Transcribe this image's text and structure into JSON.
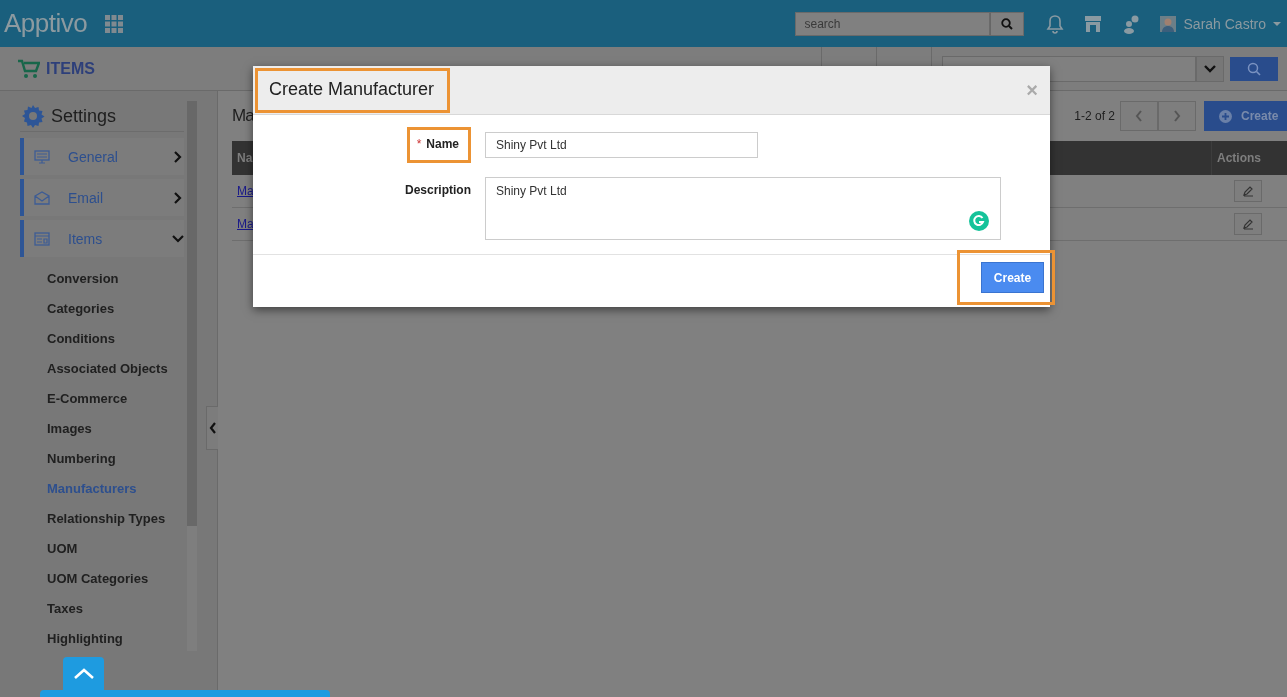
{
  "top_bar": {
    "logo": "Apptivo",
    "search": {
      "placeholder": "search"
    },
    "user": "Sarah Castro"
  },
  "app_bar": {
    "title": "ITEMS"
  },
  "sidebar": {
    "title": "Settings",
    "sections": [
      {
        "label": "General",
        "expanded": false
      },
      {
        "label": "Email",
        "expanded": false
      },
      {
        "label": "Items",
        "expanded": true
      }
    ],
    "items": [
      {
        "label": "Conversion",
        "selected": false
      },
      {
        "label": "Categories",
        "selected": false
      },
      {
        "label": "Conditions",
        "selected": false
      },
      {
        "label": "Associated Objects",
        "selected": false
      },
      {
        "label": "E-Commerce",
        "selected": false
      },
      {
        "label": "Images",
        "selected": false
      },
      {
        "label": "Numbering",
        "selected": false
      },
      {
        "label": "Manufacturers",
        "selected": true
      },
      {
        "label": "Relationship Types",
        "selected": false
      },
      {
        "label": "UOM",
        "selected": false
      },
      {
        "label": "UOM Categories",
        "selected": false
      },
      {
        "label": "Taxes",
        "selected": false
      },
      {
        "label": "Highlighting",
        "selected": false
      }
    ]
  },
  "content": {
    "heading": "Ma",
    "pagination": "1-2 of 2",
    "create_button": "Create",
    "columns": [
      "Na",
      "Actions"
    ],
    "rows": [
      "Ma",
      "Ma"
    ]
  },
  "modal": {
    "title": "Create Manufacturer",
    "close": "×",
    "fields": [
      {
        "kind": "input",
        "label": "Name",
        "required": true,
        "required_mark": "*",
        "value": "Shiny Pvt Ltd"
      },
      {
        "kind": "textarea",
        "label": "Description",
        "required": false,
        "value": "Shiny Pvt Ltd"
      }
    ],
    "button": "Create"
  }
}
